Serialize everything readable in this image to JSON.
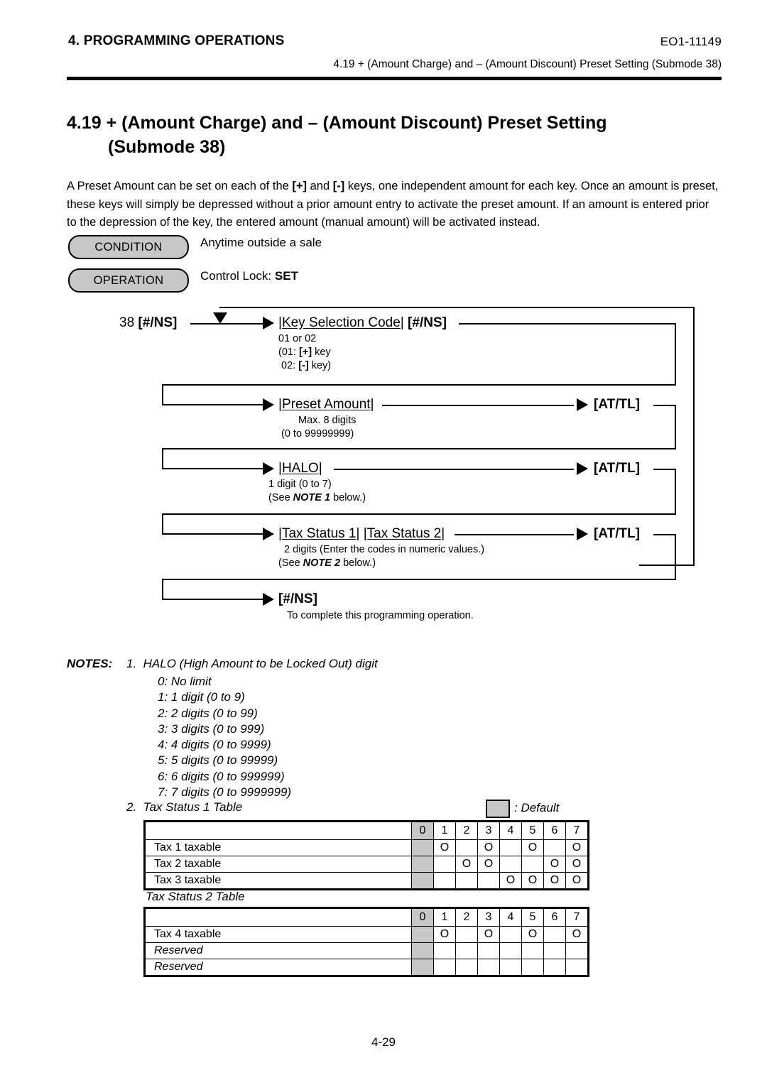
{
  "header": {
    "chapter": "4. PROGRAMMING OPERATIONS",
    "doc_code": "EO1-11149",
    "subheader": "4.19 + (Amount Charge) and – (Amount Discount) Preset Setting (Submode 38)"
  },
  "section": {
    "title_line1": "4.19  + (Amount Charge) and – (Amount Discount) Preset Setting",
    "title_line2": "(Submode 38)"
  },
  "intro": {
    "p1_a": "A Preset Amount can be set on each of the ",
    "p1_plus": "[+]",
    "p1_b": " and ",
    "p1_minus": "[-]",
    "p1_c": " keys, one independent amount for each key. Once an amount is preset, these keys will simply be depressed without a prior amount entry to activate the preset amount.  If an amount is entered prior to the depression of the key, the entered amount (manual amount) will be activated instead."
  },
  "condition": {
    "label": "CONDITION",
    "value": "Anytime outside a sale"
  },
  "operation": {
    "label": "OPERATION",
    "value_prefix": "Control Lock: ",
    "value_bold": "SET"
  },
  "flow": {
    "start": {
      "number": "38",
      "key": "[#/NS]"
    },
    "steps": [
      {
        "main_open": "|",
        "main_label": "Key Selection Code",
        "main_close": "|",
        "main_key": "[#/NS]",
        "sub": [
          "01 or 02",
          "(01: [+] key",
          " 02: [-] key)"
        ],
        "terminator": ""
      },
      {
        "main_open": "|",
        "main_label": "Preset Amount",
        "main_close": "|",
        "main_key": "",
        "sub": [
          "Max. 8 digits",
          "(0 to 99999999)"
        ],
        "terminator": "[AT/TL]"
      },
      {
        "main_open": "|",
        "main_label": "HALO",
        "main_close": "|",
        "main_key": "",
        "sub": [
          "1 digit (0 to 7)",
          "(See NOTE 1 below.)"
        ],
        "terminator": "[AT/TL]"
      },
      {
        "main_open": "|",
        "main_label": "Tax Status 1",
        "main_close": "|",
        "main_label2": "Tax Status 2",
        "main_key": "",
        "sub": [
          "2 digits (Enter the codes in numeric values.)",
          "(See NOTE 2 below.)"
        ],
        "terminator": "[AT/TL]"
      }
    ],
    "final": {
      "key": "[#/NS]",
      "note": "To complete this programming operation."
    }
  },
  "notes": {
    "label": "NOTES:",
    "note1_num": "1.",
    "note1_head": "HALO (High Amount to be Locked Out) digit",
    "note1_items": [
      "0: No limit",
      "1: 1 digit (0 to 9)",
      "2: 2 digits (0 to 99)",
      "3: 3 digits (0 to 999)",
      "4: 4 digits (0 to 9999)",
      "5: 5 digits (0 to 99999)",
      "6: 6 digits (0 to 999999)",
      "7: 7 digits (0 to 9999999)"
    ],
    "note2_num": "2.",
    "note2_head": "Tax Status 1 Table",
    "legend": ": Default"
  },
  "tables": {
    "table1": {
      "title": "Tax Status 1 Table",
      "columns": [
        "0",
        "1",
        "2",
        "3",
        "4",
        "5",
        "6",
        "7"
      ],
      "default_column": "0",
      "mark": "O",
      "rows": [
        {
          "label": "Tax 1 taxable",
          "marks": [
            false,
            true,
            false,
            true,
            false,
            true,
            false,
            true
          ]
        },
        {
          "label": "Tax 2 taxable",
          "marks": [
            false,
            false,
            true,
            true,
            false,
            false,
            true,
            true
          ]
        },
        {
          "label": "Tax 3 taxable",
          "marks": [
            false,
            false,
            false,
            false,
            true,
            true,
            true,
            true
          ]
        }
      ]
    },
    "table2": {
      "title": "Tax Status 2 Table",
      "columns": [
        "0",
        "1",
        "2",
        "3",
        "4",
        "5",
        "6",
        "7"
      ],
      "default_column": "0",
      "mark": "O",
      "rows": [
        {
          "label": "Tax 4 taxable",
          "reserved": false,
          "marks": [
            false,
            true,
            false,
            true,
            false,
            true,
            false,
            true
          ]
        },
        {
          "label": "Reserved",
          "reserved": true,
          "marks": [
            false,
            false,
            false,
            false,
            false,
            false,
            false,
            false
          ]
        },
        {
          "label": "Reserved",
          "reserved": true,
          "marks": [
            false,
            false,
            false,
            false,
            false,
            false,
            false,
            false
          ]
        }
      ]
    }
  },
  "footer": {
    "page": "4-29"
  }
}
